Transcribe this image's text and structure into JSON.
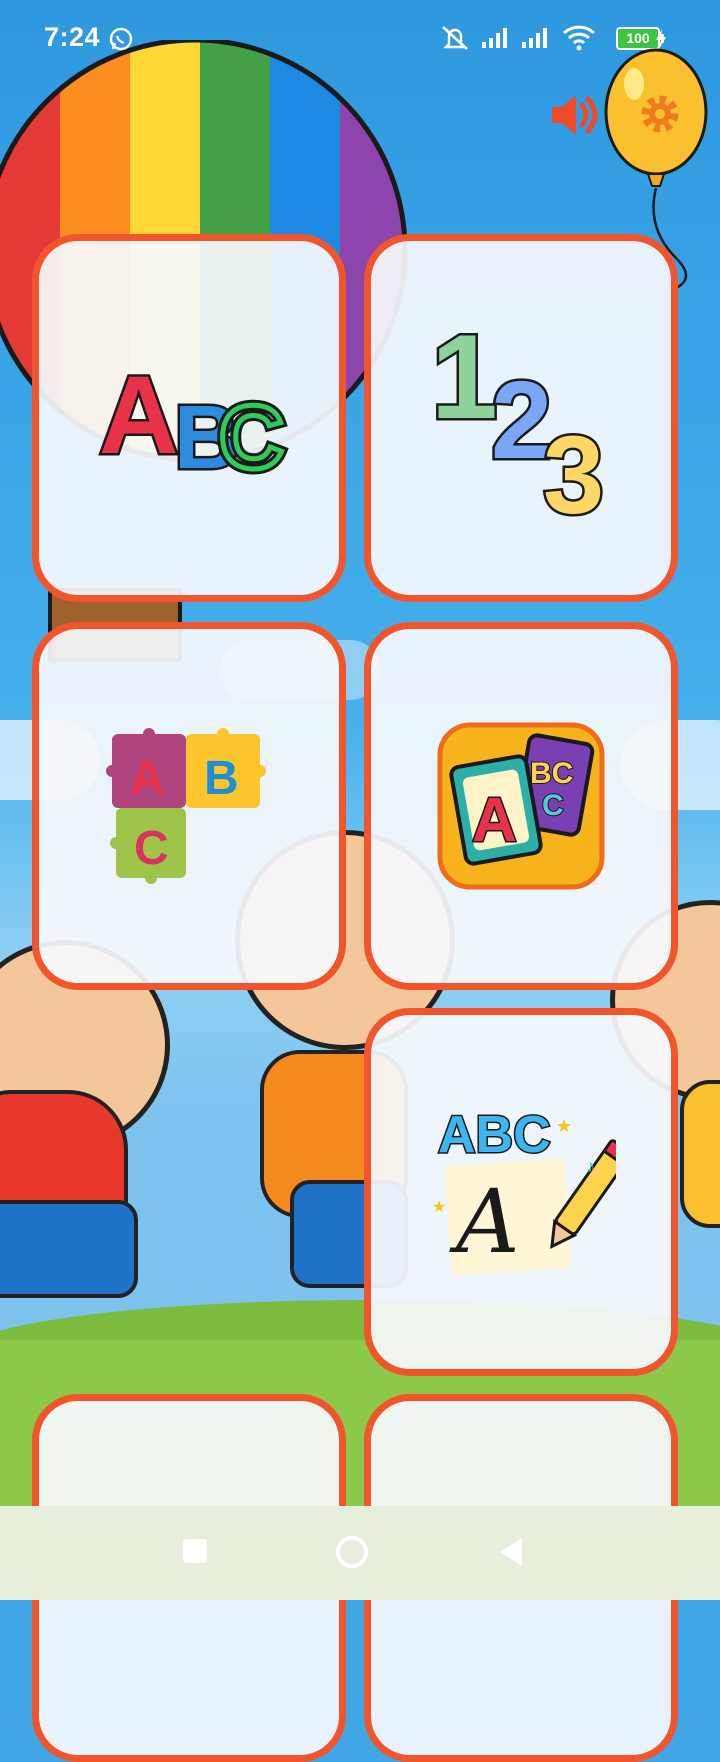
{
  "status_bar": {
    "time": "7:24",
    "battery": "100",
    "icons": [
      "whatsapp-icon",
      "mute-icon",
      "signal-icon",
      "signal-icon",
      "wifi-icon",
      "battery-icon",
      "charging-icon"
    ]
  },
  "header": {
    "sound_icon": "speaker-icon",
    "settings_icon": "gear-icon"
  },
  "tiles": [
    {
      "name": "tile-abc-letters",
      "art": "ABC"
    },
    {
      "name": "tile-123-numbers",
      "art": "123"
    },
    {
      "name": "tile-puzzle-abc",
      "art": "ABC"
    },
    {
      "name": "tile-abc-cards",
      "art": "A BC C"
    },
    {
      "name": "tile-abc-writing",
      "art": "ABC A"
    }
  ],
  "nav": {
    "icons": [
      "recents-icon",
      "home-icon",
      "back-icon"
    ]
  },
  "colors": {
    "tile_border": "#f2552c",
    "sky": "#3fa7e6",
    "grass": "#7dbb3f",
    "nav": "#e5efdc"
  }
}
